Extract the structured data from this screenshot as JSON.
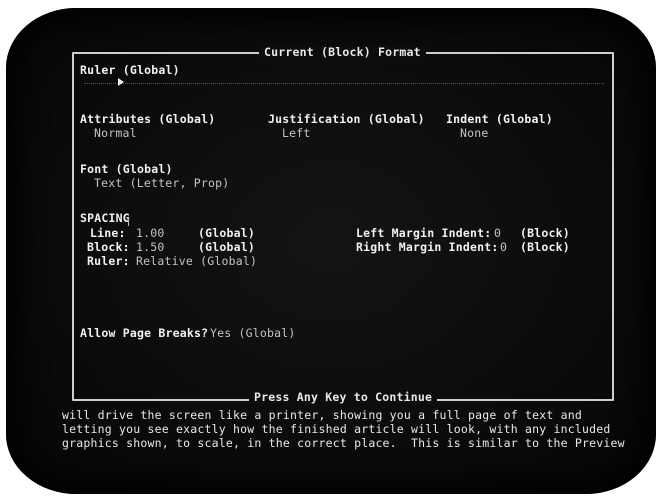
{
  "dialog": {
    "title": "Current (Block) Format",
    "footer": "Press Any Key to Continue",
    "ruler": {
      "label": "Ruler (Global)"
    },
    "attributes": {
      "label": "Attributes (Global)",
      "value": "Normal"
    },
    "justification": {
      "label": "Justification (Global)",
      "value": "Left"
    },
    "indent": {
      "label": "Indent (Global)",
      "value": "None"
    },
    "font": {
      "label": "Font (Global)",
      "value": "Text (Letter, Prop)"
    },
    "spacing": {
      "heading": "SPACING",
      "line": {
        "label": "Line:",
        "value": "1.00",
        "scope": "(Global)"
      },
      "block": {
        "label": "Block:",
        "value": "1.50",
        "scope": "(Global)"
      },
      "ruler": {
        "label": "Ruler:",
        "value": "Relative (Global)"
      }
    },
    "margins": {
      "left": {
        "label": "Left Margin Indent:",
        "value": "0",
        "scope": "(Block)"
      },
      "right": {
        "label": "Right Margin Indent:",
        "value": "0",
        "scope": "(Block)"
      }
    },
    "page_breaks": {
      "label": "Allow Page Breaks?",
      "value": "Yes (Global)"
    }
  },
  "body_text": [
    "will drive the screen like a printer, showing you a full page of text and",
    "letting you see exactly how the finished article will look, with any included",
    "graphics shown, to scale, in the correct place.  This is similar to the Preview"
  ]
}
